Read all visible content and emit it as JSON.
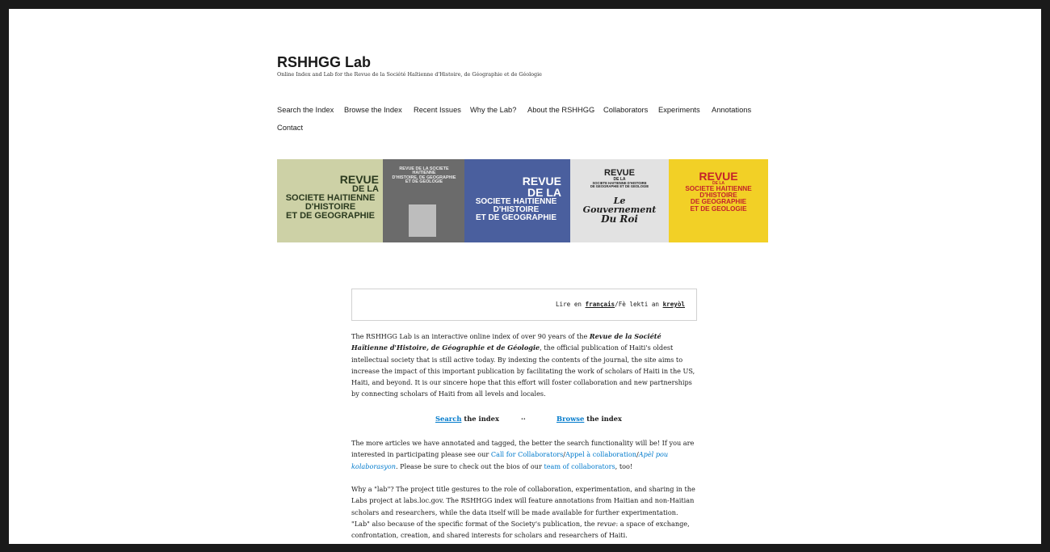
{
  "site": {
    "title": "RSHHGG Lab",
    "description": "Online Index and Lab for the Revue de la Société Haïtienne d'Histoire, de Géographie et de Géologie"
  },
  "nav": {
    "items": [
      "Search the Index",
      "Browse the Index",
      "Recent Issues",
      "Why the Lab?",
      "About the RSHHGG",
      "Collaborators",
      "Experiments",
      "Annotations",
      "Contact"
    ]
  },
  "banner": {
    "covers": [
      {
        "top": "REVUE",
        "lines": [
          "DE LA",
          "SOCIETE HAITIENNE",
          "D'HISTOIRE",
          "ET DE GEOGRAPHIE"
        ],
        "bg": "#cdd1a6",
        "fg": "#2b3a1f"
      },
      {
        "top": "REVUE DE LA SOCIETE HAITIENNE",
        "lines": [
          "D'HISTOIRE, DE GEOGRAPHIE",
          "ET DE GEOLOGIE"
        ],
        "bg": "#6b6b6b",
        "fg": "#e9e9e9"
      },
      {
        "top": "REVUE",
        "lines": [
          "DE LA",
          "SOCIETE HAITIENNE",
          "D'HISTOIRE",
          "ET DE GEOGRAPHIE"
        ],
        "bg": "#4a5f9e",
        "fg": "#ffffff"
      },
      {
        "top": "REVUE",
        "lines": [
          "DE LA",
          "SOCIETE HAITIENNE D'HISTOIRE",
          "DE GEOGRAPHIE ET DE GEOLOGIE",
          "Le Gouvernement",
          "Du Roi"
        ],
        "bg": "#e2e2e2",
        "fg": "#1f1f1f"
      },
      {
        "top": "REVUE",
        "lines": [
          "DE LA",
          "SOCIETE HAITIENNE",
          "D'HISTOIRE",
          "DE GEOGRAPHIE",
          "ET DE GEOLOGIE"
        ],
        "bg": "#f2d026",
        "fg": "#c4232b"
      }
    ]
  },
  "language": {
    "prefix": "Lire en ",
    "french": "français",
    "separator": "/Fè lekti an ",
    "kreyol": "kreyòl"
  },
  "intro": {
    "lead": "The RSHHGG Lab is an interactive online index of over 90 years of the ",
    "revue_title": "Revue de la Société Haïtienne d'Histoire, de Géographie et de Géologie",
    "body": ", the official publication of Haiti's oldest intellectual society that is still active today. By indexing the contents of the journal, the site aims to increase the impact of this important publication by facilitating the work of scholars of Haiti in the US, Haiti, and beyond. It is our sincere hope that this effort will foster collaboration and new partnerships by connecting scholars of Haiti from all levels and locales."
  },
  "actions": {
    "search_link": "Search",
    "search_rest": " the index",
    "separator": "··",
    "browse_link": "Browse",
    "browse_rest": " the index"
  },
  "collab": {
    "text1": "The more articles we have annotated and tagged, the better the search functionality will be! If you are interested in participating please see our ",
    "link1": "Call for Collaborators",
    "slash1": "/",
    "link2": "Appel à collaboration",
    "slash2": "/",
    "link3": "Apèl pou kolaborasyon",
    "text2": ". Please be sure to check out the bios of our ",
    "link4": "team of collaborators",
    "text3": ", too!"
  },
  "why": {
    "text1": "Why a \"lab\"? The project title gestures to the role of collaboration, experimentation, and sharing in the Labs project at labs.loc.gov. The RSHHGG index will feature annotations from Haitian and non-Haitian scholars and researchers, while the data itself will be made available for further experimentation. \"Lab\" also because of the specific format of the Society's publication, the ",
    "revue_word": "revue",
    "text2": ": a space of exchange, confrontation, creation, and shared interests for scholars and researchers of Haiti."
  }
}
